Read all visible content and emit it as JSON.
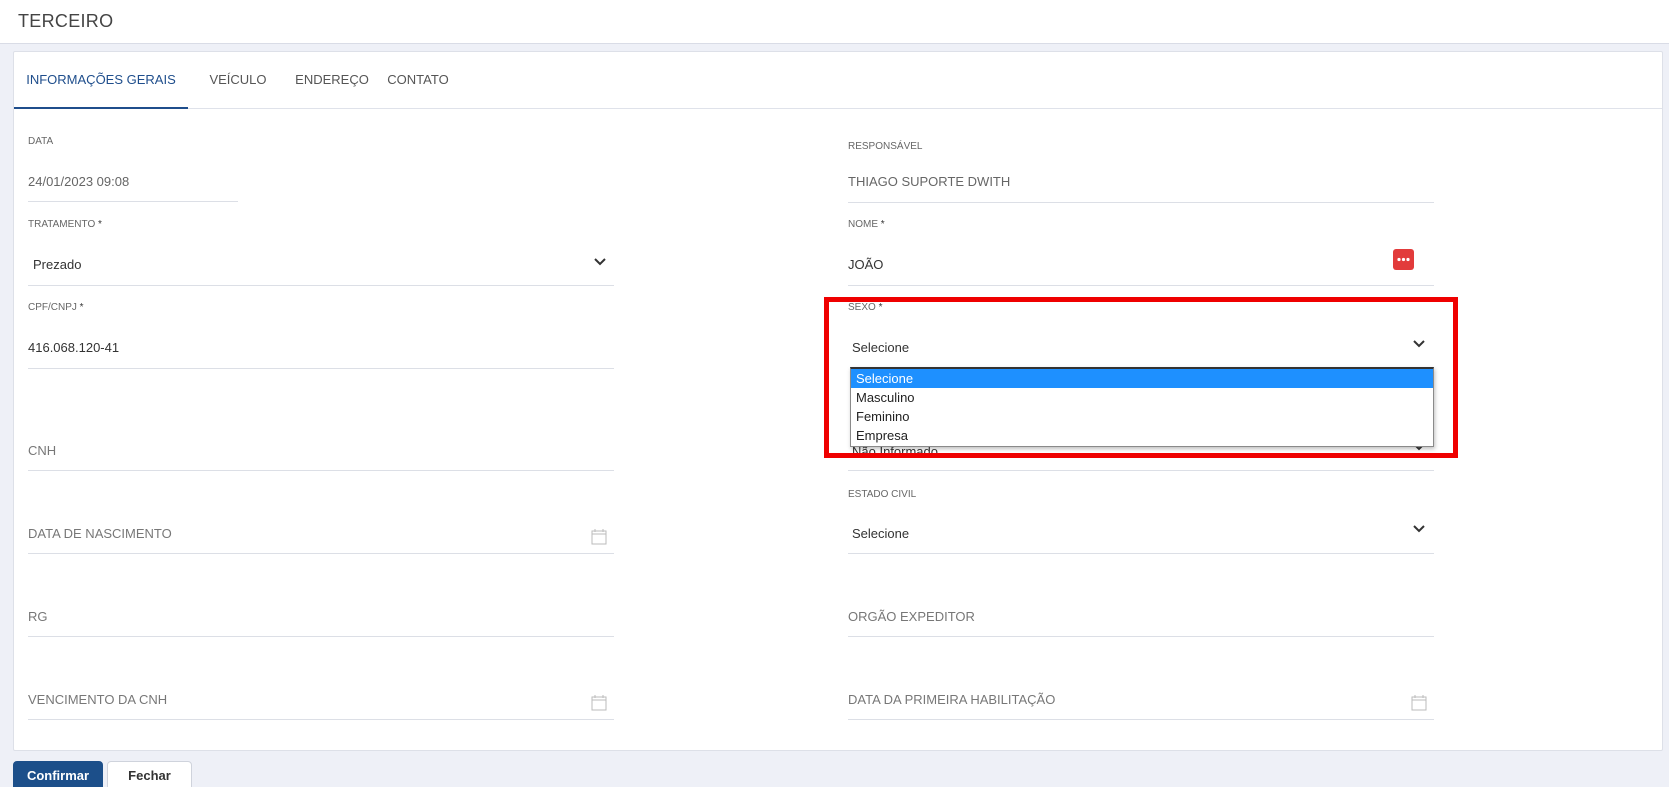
{
  "page": {
    "title": "TERCEIRO"
  },
  "tabs": [
    {
      "label": "INFORMAÇÕES GERAIS",
      "active": true
    },
    {
      "label": "VEÍCULO",
      "active": false
    },
    {
      "label": "ENDEREÇO",
      "active": false
    },
    {
      "label": "CONTATO",
      "active": false
    }
  ],
  "form": {
    "data": {
      "label": "DATA",
      "value": "24/01/2023 09:08"
    },
    "responsavel": {
      "label": "RESPONSÁVEL",
      "value": "THIAGO SUPORTE DWITH"
    },
    "tratamento": {
      "label": "TRATAMENTO",
      "value": "Prezado"
    },
    "nome": {
      "label": "NOME",
      "value": "JOÃO"
    },
    "cpf": {
      "label": "CPF/CNPJ",
      "value": "416.068.120-41"
    },
    "sexo": {
      "label": "SEXO",
      "value": "Selecione"
    },
    "hidden_select_value": "Não Informado",
    "cnh": {
      "placeholder": "CNH"
    },
    "data_nascimento": {
      "placeholder": "DATA DE NASCIMENTO"
    },
    "estado_civil": {
      "label": "ESTADO CIVIL",
      "value": "Selecione"
    },
    "rg": {
      "placeholder": "RG"
    },
    "orgao_expeditor": {
      "placeholder": "ORGÃO EXPEDITOR"
    },
    "vencimento_cnh": {
      "placeholder": "VENCIMENTO DA CNH"
    },
    "data_primeira_habilitacao": {
      "placeholder": "DATA DA PRIMEIRA HABILITAÇÃO"
    }
  },
  "sexo_options": [
    "Selecione",
    "Masculino",
    "Feminino",
    "Empresa"
  ],
  "buttons": {
    "confirm": "Confirmar",
    "close": "Fechar"
  },
  "colors": {
    "accent": "#1c4f8a",
    "highlight": "#ef0000",
    "selected_option": "#1e90ff",
    "icon_red": "#e23b3b"
  },
  "icons": {
    "chevron": "chevron-down-icon",
    "calendar": "calendar-icon",
    "input_menu": "dots-icon"
  }
}
